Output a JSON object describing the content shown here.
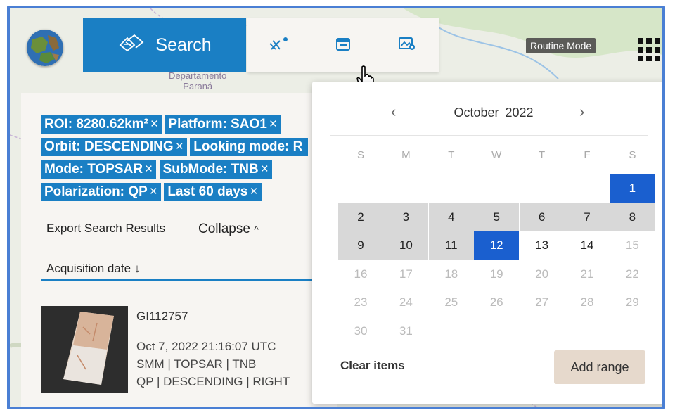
{
  "header": {
    "search_label": "Search",
    "routine_mode_label": "Routine Mode",
    "icons": [
      "globe-icon",
      "search-icon",
      "satellite-icon",
      "calendar-icon",
      "image-settings-icon",
      "apps-grid-icon"
    ]
  },
  "map": {
    "region_label_line1": "Departamento",
    "region_label_line2": "Paraná"
  },
  "filters": {
    "rows": [
      [
        {
          "label": "ROI: 8280.62km²",
          "close": "×"
        },
        {
          "label": "Platform: SAO1",
          "close": "×"
        }
      ],
      [
        {
          "label": "Orbit: DESCENDING",
          "close": "×"
        },
        {
          "label": "Looking mode: R",
          "close": ""
        }
      ],
      [
        {
          "label": "Mode: TOPSAR",
          "close": "×"
        },
        {
          "label": "SubMode: TNB",
          "close": "×"
        }
      ],
      [
        {
          "label": "Polarization: QP",
          "close": "×"
        },
        {
          "label": "Last 60 days",
          "close": "×"
        }
      ]
    ],
    "export_label": "Export Search Results",
    "collapse_label": "Collapse",
    "collapse_caret": "^"
  },
  "results": {
    "sort_label": "Acquisition date",
    "sort_arrow": "↓",
    "items": [
      {
        "id": "GI112757",
        "date": "Oct 7, 2022 21:16:07 UTC",
        "line2": "SMM | TOPSAR | TNB",
        "line3": "QP | DESCENDING | RIGHT"
      }
    ]
  },
  "calendar": {
    "month": "October",
    "year": "2022",
    "prev": "‹",
    "next": "›",
    "weekdays": [
      "S",
      "M",
      "T",
      "W",
      "T",
      "F",
      "S"
    ],
    "weeks": [
      [
        {
          "d": ""
        },
        {
          "d": ""
        },
        {
          "d": ""
        },
        {
          "d": ""
        },
        {
          "d": ""
        },
        {
          "d": ""
        },
        {
          "d": "1",
          "s": "sel"
        }
      ],
      [
        {
          "d": "2",
          "s": "range"
        },
        {
          "d": "3",
          "s": "range"
        },
        {
          "d": "4",
          "s": "range"
        },
        {
          "d": "5",
          "s": "range"
        },
        {
          "d": "6",
          "s": "range"
        },
        {
          "d": "7",
          "s": "range"
        },
        {
          "d": "8",
          "s": "range"
        }
      ],
      [
        {
          "d": "9",
          "s": "range"
        },
        {
          "d": "10",
          "s": "range"
        },
        {
          "d": "11",
          "s": "range"
        },
        {
          "d": "12",
          "s": "sel"
        },
        {
          "d": "13",
          "s": "dark"
        },
        {
          "d": "14",
          "s": "dark"
        },
        {
          "d": "15",
          "s": "muted"
        }
      ],
      [
        {
          "d": "16",
          "s": "muted"
        },
        {
          "d": "17",
          "s": "muted"
        },
        {
          "d": "18",
          "s": "muted"
        },
        {
          "d": "19",
          "s": "muted"
        },
        {
          "d": "20",
          "s": "muted"
        },
        {
          "d": "21",
          "s": "muted"
        },
        {
          "d": "22",
          "s": "muted"
        }
      ],
      [
        {
          "d": "23",
          "s": "muted"
        },
        {
          "d": "24",
          "s": "muted"
        },
        {
          "d": "25",
          "s": "muted"
        },
        {
          "d": "26",
          "s": "muted"
        },
        {
          "d": "27",
          "s": "muted"
        },
        {
          "d": "28",
          "s": "muted"
        },
        {
          "d": "29",
          "s": "muted"
        }
      ],
      [
        {
          "d": "30",
          "s": "muted"
        },
        {
          "d": "31",
          "s": "muted"
        },
        {
          "d": ""
        },
        {
          "d": ""
        },
        {
          "d": ""
        },
        {
          "d": ""
        },
        {
          "d": ""
        }
      ]
    ],
    "clear_label": "Clear items",
    "add_range_label": "Add range"
  },
  "colors": {
    "accent": "#1a7fc4",
    "selected": "#1a5fcf",
    "range": "#d8d8d8",
    "frame": "#4a7fd4"
  }
}
